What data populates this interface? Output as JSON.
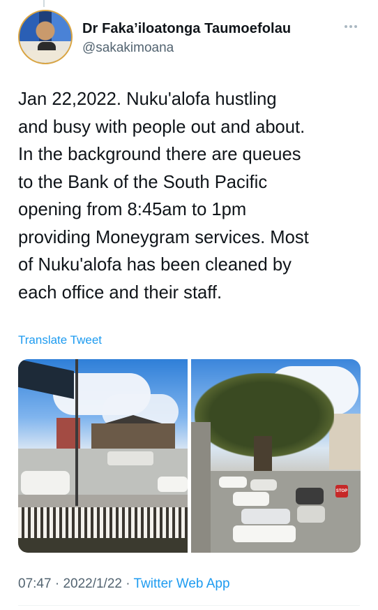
{
  "tweet": {
    "author_name": "Dr Faka’iloatonga Taumoefolau",
    "author_handle": "@sakakimoana",
    "text": "Jan 22,2022. Nuku'alofa hustling\nand busy with people out and about.\nIn the background there are queues\nto the Bank of the South Pacific\nopening from 8:45am to 1pm\nproviding Moneygram services. Most\nof Nuku'alofa has been cleaned by\neach office and their staff.",
    "translate_label": "Translate Tweet",
    "time": "07:47",
    "date": "2022/1/22",
    "separator": " · ",
    "source_app": "Twitter Web App",
    "stop_sign_text": "STOP"
  },
  "icons": {
    "more": "more-horizontal-icon"
  },
  "colors": {
    "link": "#1d9bf0",
    "secondary_text": "#536471",
    "primary_text": "#0f1419"
  }
}
